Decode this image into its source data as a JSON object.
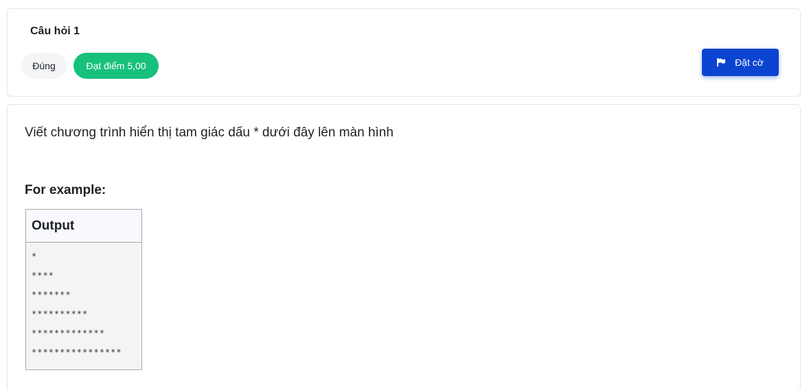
{
  "header": {
    "question_title": "Câu hỏi 1",
    "state_badge": "Đúng",
    "grade_badge": "Đạt điểm 5,00",
    "flag_button_label": "Đặt cờ",
    "flag_icon": "flag-icon"
  },
  "content": {
    "question_text": "Viết chương trình hiển thị tam giác dấu * dưới đây lên màn hình",
    "example_label": "For example:",
    "output_header": "Output",
    "output_lines": [
      "*",
      "****",
      "*******",
      "**********",
      "*************",
      "****************"
    ]
  },
  "colors": {
    "grade_badge_bg": "#17c17b",
    "flag_button_bg": "#0a44d0",
    "state_badge_bg": "#f4f5f6"
  }
}
